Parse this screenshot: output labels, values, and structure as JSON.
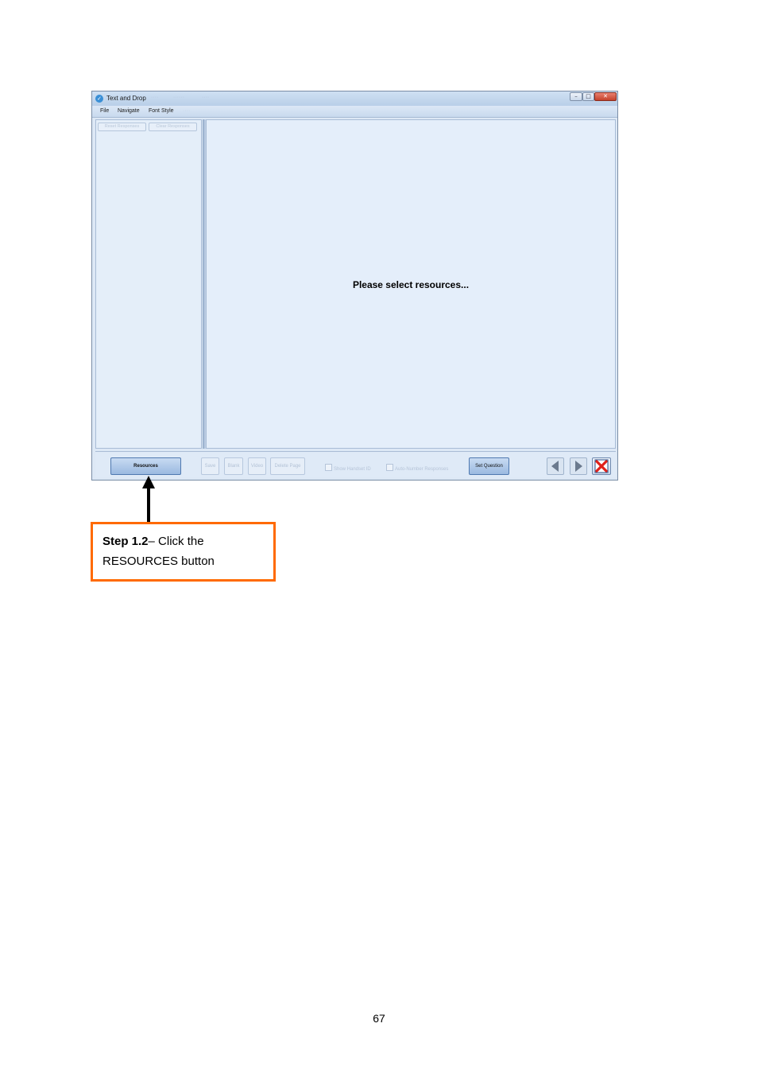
{
  "window": {
    "title": "Text and Drop",
    "title_faded": [
      "····",
      "······",
      "····"
    ],
    "controls": {
      "minimize": "–",
      "maximize": "□",
      "close": "✕"
    }
  },
  "menu": {
    "items": [
      "File",
      "Navigate",
      "Font Style"
    ],
    "faded_item": "····"
  },
  "left_panel": {
    "buttons": [
      "Reset Responses",
      "Clear Responses"
    ]
  },
  "main_panel": {
    "message": "Please select resources..."
  },
  "toolbar": {
    "resources_label": "Resources",
    "save_label": "Save",
    "blank_label": "Blank",
    "video_label": "Video",
    "delete_page_label": "Delete Page",
    "show_handset_id_label": "Show Handset ID",
    "auto_number_label": "Auto-Number Responses",
    "set_question_label": "Set Question"
  },
  "annotation": {
    "step_bold": "Step 1.2",
    "step_text": "– Click the",
    "step_text_line2": "RESOURCES button",
    "border_color": "#ff6a00"
  },
  "footer": {
    "page_number": "67"
  }
}
